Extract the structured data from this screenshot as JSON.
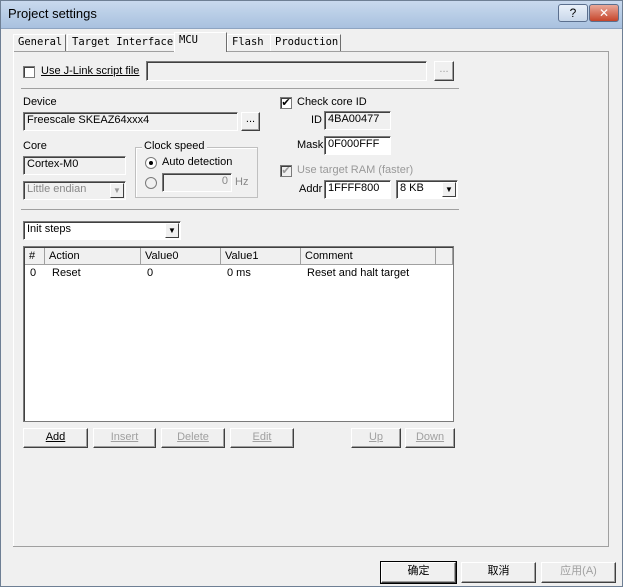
{
  "window": {
    "title": "Project settings",
    "help_glyph": "?",
    "close_glyph": "✕"
  },
  "tabs": [
    {
      "label": "General"
    },
    {
      "label": "Target Interface"
    },
    {
      "label": "MCU"
    },
    {
      "label": "Flash"
    },
    {
      "label": "Production"
    }
  ],
  "jlink_script": {
    "checkbox_label": "Use J-Link script file",
    "path_value": "",
    "browse_label": "..."
  },
  "device": {
    "label": "Device",
    "value": "Freescale SKEAZ64xxx4",
    "browse_label": "..."
  },
  "core": {
    "label": "Core",
    "value": "Cortex-M0",
    "endian_value": "Little endian"
  },
  "clock_speed": {
    "group_label": "Clock speed",
    "auto_label": "Auto detection",
    "manual_value": "0",
    "unit": "Hz"
  },
  "check_core": {
    "checkbox_label": "Check core ID",
    "checked_glyph": "✔",
    "id_label": "ID",
    "id_value": "4BA00477",
    "mask_label": "Mask",
    "mask_value": "0F000FFF"
  },
  "target_ram": {
    "checkbox_label": "Use target RAM (faster)",
    "checked_glyph": "✔",
    "addr_label": "Addr",
    "addr_value": "1FFFF800",
    "size_value": "8 KB"
  },
  "steps": {
    "selector_value": "Init steps",
    "columns": [
      "#",
      "Action",
      "Value0",
      "Value1",
      "Comment"
    ],
    "rows": [
      {
        "num": "0",
        "action": "Reset",
        "value0": "0",
        "value1": "0 ms",
        "comment": "Reset and halt target"
      }
    ]
  },
  "step_buttons": {
    "add": "Add",
    "insert": "Insert",
    "delete": "Delete",
    "edit": "Edit",
    "up": "Up",
    "down": "Down"
  },
  "dialog_buttons": {
    "ok": "确定",
    "cancel": "取消",
    "apply": "应用(A)"
  },
  "icons": {
    "dropdown_arrow": "▼"
  }
}
